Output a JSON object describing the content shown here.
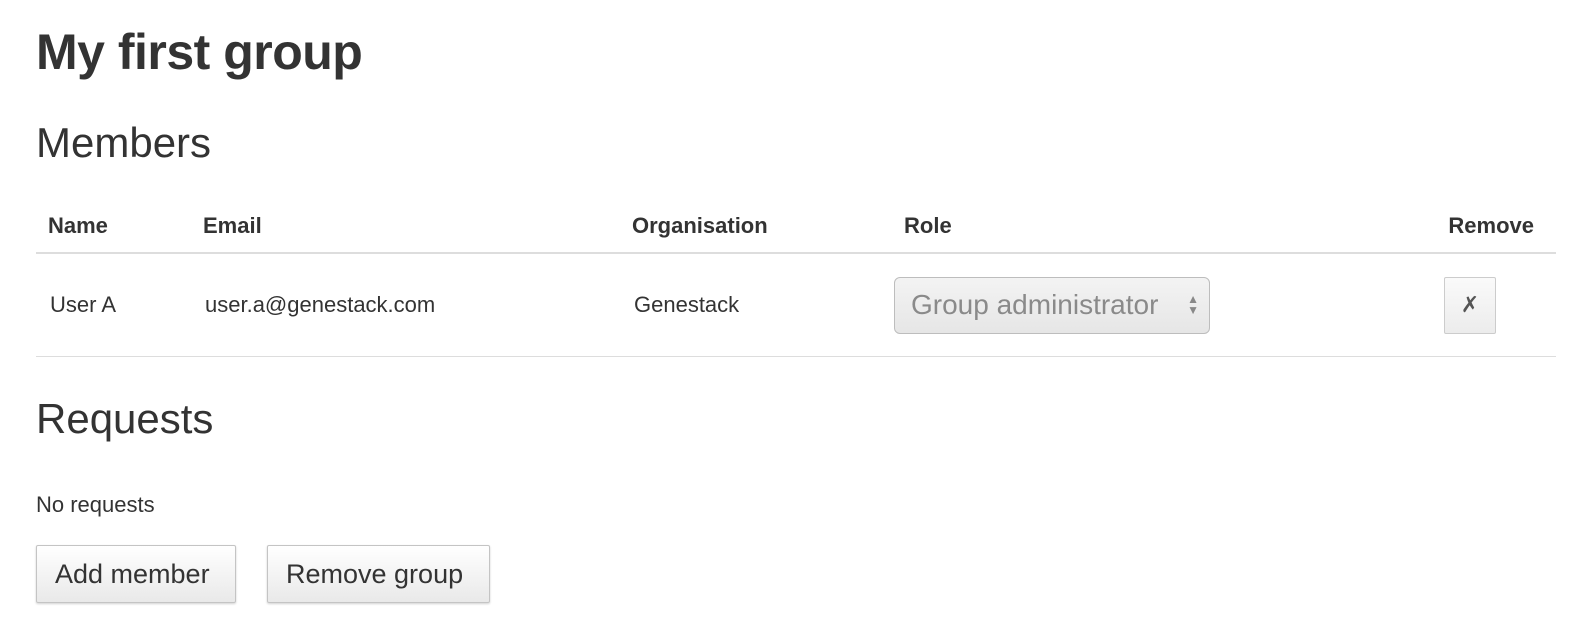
{
  "page": {
    "title": "My first group"
  },
  "members": {
    "heading": "Members",
    "columns": {
      "name": "Name",
      "email": "Email",
      "organisation": "Organisation",
      "role": "Role",
      "remove": "Remove"
    },
    "rows": [
      {
        "name": "User A",
        "email": "user.a@genestack.com",
        "organisation": "Genestack",
        "role": "Group administrator",
        "remove_glyph": "✗"
      }
    ]
  },
  "requests": {
    "heading": "Requests",
    "empty_text": "No requests"
  },
  "actions": {
    "add_member_label": "Add member",
    "remove_group_label": "Remove group"
  },
  "icons": {
    "select_arrows": "up-down-arrows-icon",
    "remove": "x-mark-icon"
  }
}
